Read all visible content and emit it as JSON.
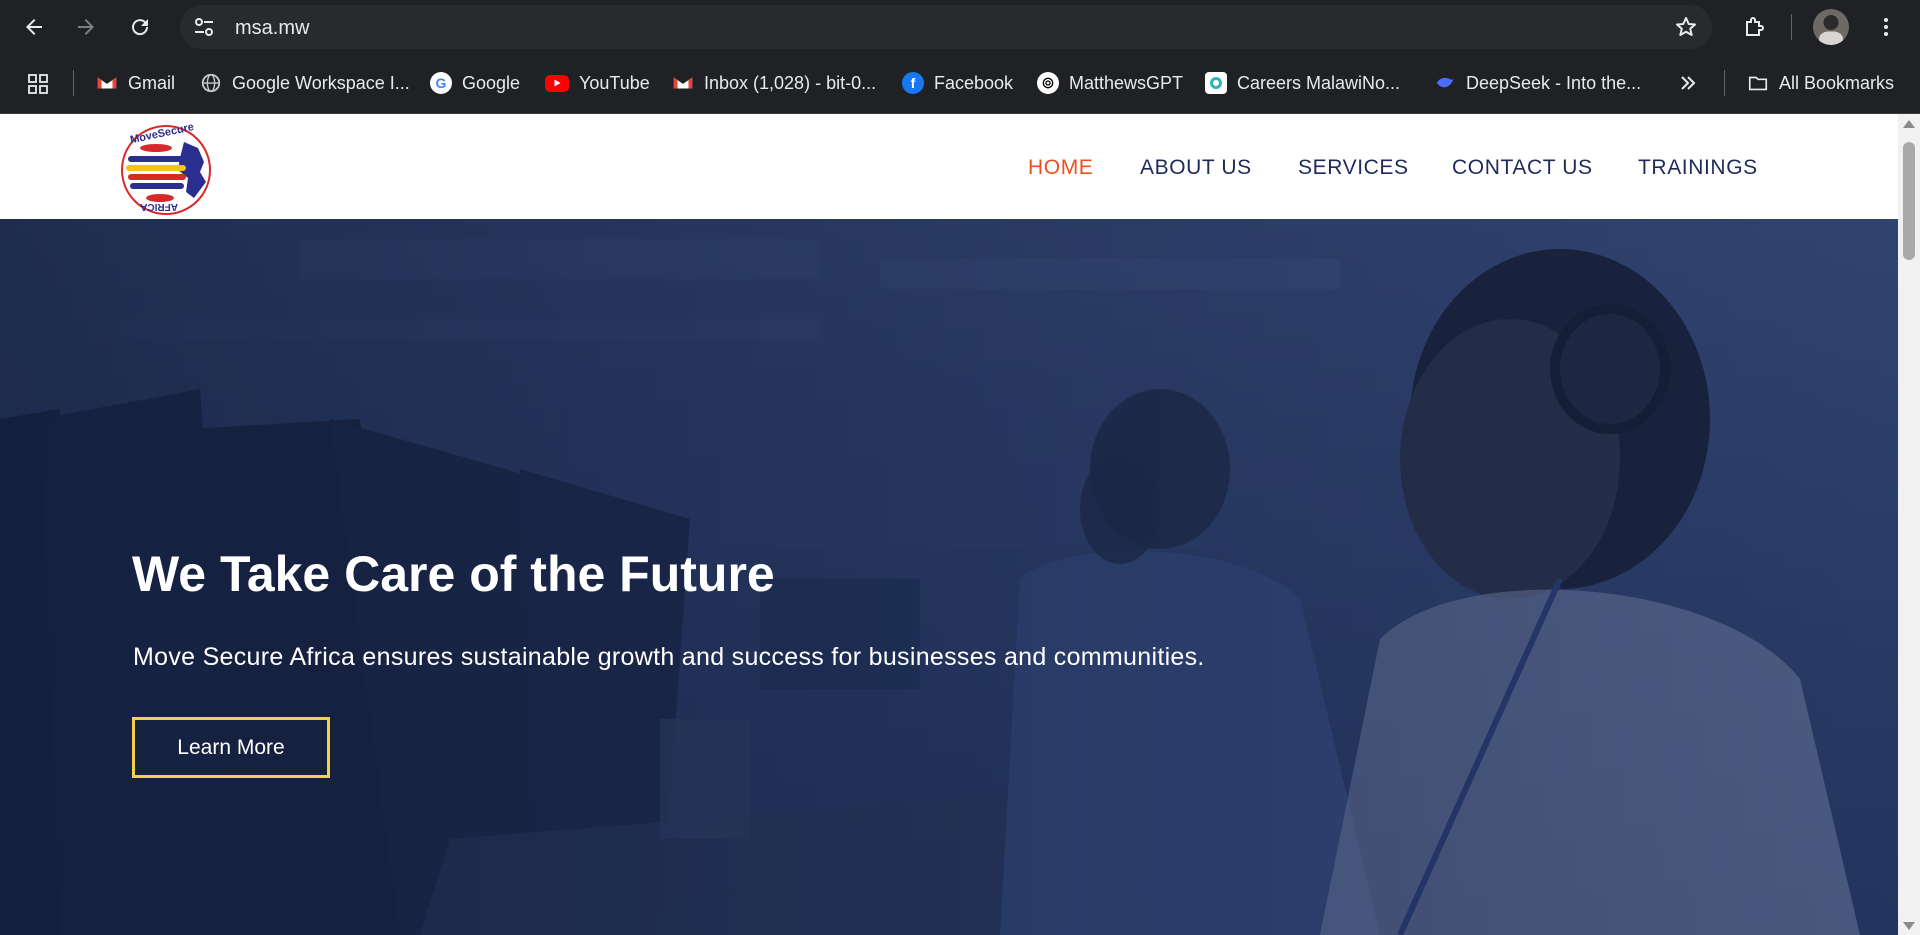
{
  "browser": {
    "url": "msa.mw",
    "bookmarks": [
      {
        "label": "Gmail",
        "icon": "gmail-icon"
      },
      {
        "label": "Google Workspace I...",
        "icon": "globe-icon"
      },
      {
        "label": "Google",
        "icon": "google-icon"
      },
      {
        "label": "YouTube",
        "icon": "youtube-icon"
      },
      {
        "label": "Inbox (1,028) - bit-0...",
        "icon": "gmail-icon"
      },
      {
        "label": "Facebook",
        "icon": "facebook-icon"
      },
      {
        "label": "MatthewsGPT",
        "icon": "openai-icon"
      },
      {
        "label": "Careers MalawiNo...",
        "icon": "careers-icon"
      },
      {
        "label": "DeepSeek - Into the...",
        "icon": "deepseek-icon"
      }
    ],
    "all_bookmarks_label": "All Bookmarks"
  },
  "site": {
    "logo_text_top": "MoveSecure",
    "logo_text_bottom": "AFRICA",
    "nav": [
      {
        "label": "HOME",
        "active": true
      },
      {
        "label": "ABOUT US",
        "active": false
      },
      {
        "label": "SERVICES",
        "active": false
      },
      {
        "label": "CONTACT US",
        "active": false
      },
      {
        "label": "TRAININGS",
        "active": false
      }
    ],
    "hero": {
      "title": "We Take Care of the Future",
      "subtitle": "Move Secure Africa ensures sustainable growth and success for businesses and communities.",
      "cta_label": "Learn More"
    }
  },
  "colors": {
    "nav_text": "#1f2a5c",
    "nav_active": "#e8531f",
    "cta_border": "#f1d34b",
    "hero_overlay": "#1c2b52"
  }
}
